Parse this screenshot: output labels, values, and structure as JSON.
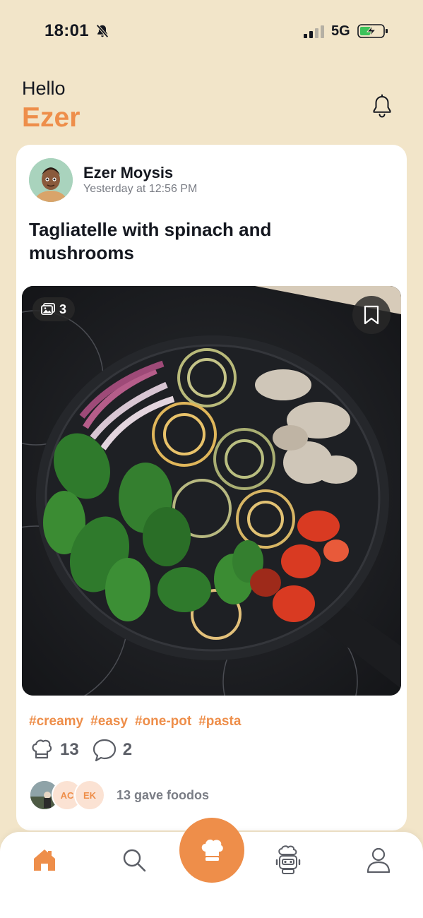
{
  "status_bar": {
    "time": "18:01",
    "network": "5G",
    "icons": [
      "bell-slash-icon",
      "signal-icon",
      "battery-charging-icon"
    ]
  },
  "header": {
    "greeting": "Hello",
    "username": "Ezer",
    "notification_icon": "bell-icon"
  },
  "post": {
    "author": "Ezer Moysis",
    "timestamp": "Yesterday at 12:56 PM",
    "title": "Tagliatelle with spinach and mushrooms",
    "image_count": "3",
    "tags": [
      "#creamy",
      "#easy",
      "#one-pot",
      "#pasta"
    ],
    "likes": "13",
    "comments": "2",
    "foodos_avatars": [
      "",
      "AC",
      "EK"
    ],
    "foodos_text": "13 gave foodos"
  },
  "nav": {
    "items": [
      "home-icon",
      "search-icon",
      "chef-hat-icon",
      "robot-chef-icon",
      "profile-icon"
    ],
    "active": "home-icon"
  },
  "colors": {
    "accent": "#ee8e4a",
    "background": "#f2e5c9",
    "card": "#ffffff",
    "text": "#14171f",
    "muted": "#7a7d85"
  }
}
